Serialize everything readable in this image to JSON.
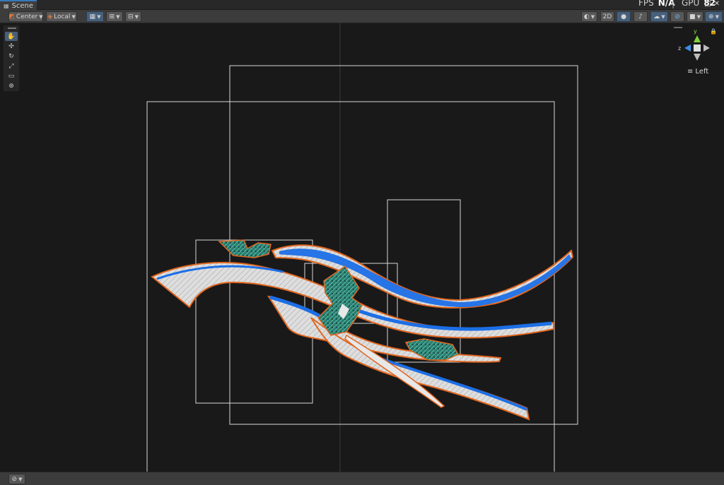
{
  "tab": {
    "label": "Scene",
    "icon": "grid-icon"
  },
  "perf": {
    "fps_label": "FPS",
    "fps_value": "N/A",
    "gpu_label": "GPU",
    "gpu_value": "82"
  },
  "toolbar": {
    "pivot_mode": "Center",
    "pivot_rotation": "Local",
    "mode_2d": "2D"
  },
  "tools": [
    "hand-tool",
    "move-tool",
    "rotate-tool",
    "scale-tool",
    "rect-tool",
    "transform-tool"
  ],
  "gizmo": {
    "y_label": "y",
    "z_label": "z",
    "view_label": "Left"
  },
  "colors": {
    "background": "#191919",
    "toolbar": "#3c3c3c",
    "active": "#46607c",
    "outline": "#e0661f",
    "wave_blue": "#1f6fe8",
    "wave_white": "#e8e8e8",
    "teal_cube": "#2f8c7c"
  }
}
